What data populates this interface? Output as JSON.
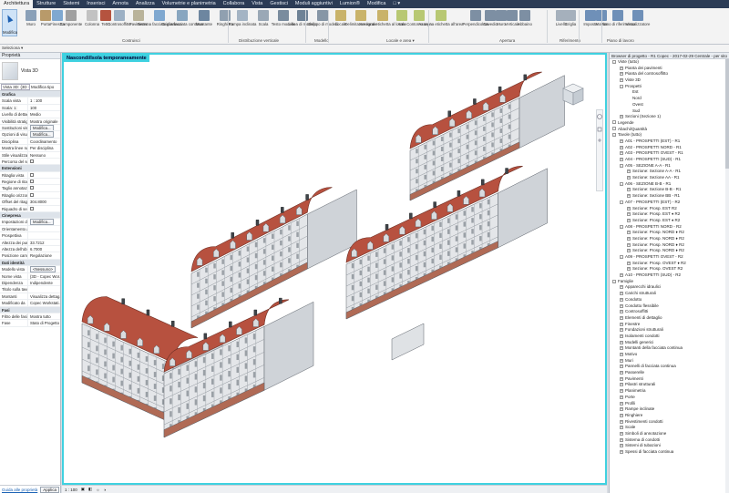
{
  "ribbon": {
    "tabs": [
      "Architettura",
      "Strutture",
      "Sistemi",
      "Inserisci",
      "Annota",
      "Analizza",
      "Volumetrie e planimetria",
      "Collabora",
      "Vista",
      "Gestisci",
      "Moduli aggiuntivi",
      "Lumion®",
      "Modifica",
      "□ ▾"
    ],
    "active_tab": "Architettura",
    "modify_label": "Modifica",
    "select_label": "Seleziona ▾",
    "buttons": [
      {
        "label": "Muro",
        "icon": "wall-icon"
      },
      {
        "label": "Porta",
        "icon": "door-icon"
      },
      {
        "label": "Finestra",
        "icon": "window-icon"
      },
      {
        "label": "Componente",
        "icon": "component-icon"
      },
      {
        "label": "Colonna",
        "icon": "column-icon"
      },
      {
        "label": "Tetto",
        "icon": "roof-icon"
      },
      {
        "label": "Controsoffitto",
        "icon": "ceiling-icon"
      },
      {
        "label": "Pavimento",
        "icon": "floor-icon"
      },
      {
        "label": "Sistema facciata continua",
        "icon": "curtain-system-icon"
      },
      {
        "label": "Griglia facciata continua",
        "icon": "curtain-grid-icon"
      },
      {
        "label": "Montante",
        "icon": "mullion-icon"
      },
      {
        "label": "Ringhiera",
        "icon": "railing-icon"
      },
      {
        "label": "Rampa inclinata",
        "icon": "ramp-icon"
      },
      {
        "label": "Scala",
        "icon": "stair-icon"
      },
      {
        "label": "Testo modello",
        "icon": "model-text-icon"
      },
      {
        "label": "Linea di modello",
        "icon": "model-line-icon"
      },
      {
        "label": "Gruppo di modelli",
        "icon": "model-group-icon"
      },
      {
        "label": "Locale",
        "icon": "room-icon"
      },
      {
        "label": "Delimitatore locale",
        "icon": "room-separator-icon"
      },
      {
        "label": "Assegna etichetta al locale",
        "icon": "tag-room-icon"
      },
      {
        "label": "Area",
        "icon": "area-icon"
      },
      {
        "label": "Contorno area",
        "icon": "area-boundary-icon"
      },
      {
        "label": "Assegna etichetta all'area",
        "icon": "tag-area-icon"
      },
      {
        "label": "Perpendicolare",
        "icon": "by-face-icon"
      },
      {
        "label": "Cavedio",
        "icon": "shaft-icon"
      },
      {
        "label": "Muro",
        "icon": "wall-opening-icon"
      },
      {
        "label": "Verticale",
        "icon": "vertical-icon"
      },
      {
        "label": "Abbaino",
        "icon": "dormer-icon"
      },
      {
        "label": "Livello",
        "icon": "level-icon"
      },
      {
        "label": "Griglia",
        "icon": "grid-icon"
      },
      {
        "label": "Imposta",
        "icon": "set-icon"
      },
      {
        "label": "Mostra",
        "icon": "show-icon"
      },
      {
        "label": "Piano di riferimento",
        "icon": "ref-plane-icon"
      },
      {
        "label": "Visualizzatore",
        "icon": "viewer-icon"
      }
    ],
    "groups": [
      "Costruisci",
      "Distribuzione verticale",
      "Modello",
      "Locale e area ▾",
      "Apertura",
      "Riferimento",
      "Piano di lavoro"
    ]
  },
  "properties": {
    "title": "Proprietà",
    "type_name": "Vista 3D",
    "view_selector": "Vista 3D: {3D - C",
    "edit_type": "Modifica tipo",
    "rows": [
      {
        "section": "Grafica"
      },
      {
        "k": "Scala vista",
        "v": "1 : 100"
      },
      {
        "k": "Scala: 1:",
        "v": "100"
      },
      {
        "k": "Livello di dettag...",
        "v": "Medio"
      },
      {
        "k": "Visibilità stratigr...",
        "v": "Mostra originale"
      },
      {
        "k": "Sostituzioni visi...",
        "v": "Modifica...",
        "btn": true
      },
      {
        "k": "Opzioni di visua...",
        "v": "Modifica...",
        "btn": true
      },
      {
        "k": "Disciplina",
        "v": "Coordinamento"
      },
      {
        "k": "Mostra linee na...",
        "v": "Per disciplina"
      },
      {
        "k": "Stile visualizzaz...",
        "v": "Nessuno"
      },
      {
        "k": "Percorso del sole",
        "v": "",
        "cb": true
      },
      {
        "section": "Estensioni"
      },
      {
        "k": "Ritaglia vista",
        "v": "",
        "cb": true
      },
      {
        "k": "Regione di ritagl...",
        "v": "",
        "cb": true
      },
      {
        "k": "Taglio annotaz...",
        "v": "",
        "cb": true
      },
      {
        "k": "Ritaglio orizzon...",
        "v": "",
        "cb": true
      },
      {
        "k": "Offset del ritagl...",
        "v": "304.8000"
      },
      {
        "k": "Riquadro di sezi...",
        "v": "",
        "cb": true
      },
      {
        "section": "Cinepresa"
      },
      {
        "k": "Impostazioni di ...",
        "v": "Modifica...",
        "btn": true
      },
      {
        "k": "Orientamento a...",
        "v": ""
      },
      {
        "k": "Prospettiva",
        "v": ""
      },
      {
        "k": "Altezza dei punt...",
        "v": "33.7212"
      },
      {
        "k": "Altezza dell'obi...",
        "v": "6.7000"
      },
      {
        "k": "Posizione came...",
        "v": "Regolazione"
      },
      {
        "section": "Dati identità"
      },
      {
        "k": "Modello vista",
        "v": "<Nessuno>",
        "btn": true
      },
      {
        "k": "Nome vista",
        "v": "{3D - Copec Wor..."
      },
      {
        "k": "Dipendenza",
        "v": "Indipendente"
      },
      {
        "k": "Titolo sulla tavola",
        "v": ""
      },
      {
        "k": "Montanti",
        "v": "Visualizza dettag..."
      },
      {
        "k": "Modificato da",
        "v": "Copec Workstati..."
      },
      {
        "section": "Fasi"
      },
      {
        "k": "Filtro delle fasi",
        "v": "Mostra tutto"
      },
      {
        "k": "Fase",
        "v": "Stato di Progetto"
      }
    ],
    "help_link": "Guida alle proprietà",
    "apply_label": "Applica"
  },
  "view": {
    "banner": "Nascondi/Isola temporaneamente",
    "scale": "1 : 100"
  },
  "browser": {
    "title": "Browser di progetto - R1 Copec - 2017-02-29 Centrale - per sito",
    "items": [
      {
        "d": 0,
        "t": "Viste (tutto)",
        "tg": "-"
      },
      {
        "d": 1,
        "t": "Pianta dei pavimenti",
        "tg": "+"
      },
      {
        "d": 1,
        "t": "Pianta del controsoffitto",
        "tg": "+"
      },
      {
        "d": 1,
        "t": "Viste 3D",
        "tg": "+"
      },
      {
        "d": 1,
        "t": "Prospetti",
        "tg": "-"
      },
      {
        "d": 2,
        "t": "Est"
      },
      {
        "d": 2,
        "t": "Nord"
      },
      {
        "d": 2,
        "t": "Ovest"
      },
      {
        "d": 2,
        "t": "Sud"
      },
      {
        "d": 1,
        "t": "Sezioni (Sezione 1)",
        "tg": "+"
      },
      {
        "d": 0,
        "t": "Legende",
        "tg": "▦"
      },
      {
        "d": 0,
        "t": "Abachi/Quantità",
        "tg": "▦"
      },
      {
        "d": 0,
        "t": "Tavole (tutto)",
        "tg": "-"
      },
      {
        "d": 1,
        "t": "A01 - PROSPETTI (EST) - R1",
        "tg": "+"
      },
      {
        "d": 1,
        "t": "A02 - PROSPETTI NORD - R1",
        "tg": "+"
      },
      {
        "d": 1,
        "t": "A03 - PROSPETTI OVEST - R1",
        "tg": "+"
      },
      {
        "d": 1,
        "t": "A04 - PROSPETTI (SUD) - R1",
        "tg": "+"
      },
      {
        "d": 1,
        "t": "A05 - SEZIONE A-A - R1",
        "tg": "-"
      },
      {
        "d": 2,
        "t": "Sezione: Sezione A-A - R1",
        "tg": "+"
      },
      {
        "d": 2,
        "t": "Sezione: Sezione AA - R1",
        "tg": "+"
      },
      {
        "d": 1,
        "t": "A06 - SEZIONE B-B - R1",
        "tg": "-"
      },
      {
        "d": 2,
        "t": "Sezione: Sezione B-B - R1",
        "tg": "+"
      },
      {
        "d": 2,
        "t": "Sezione: Sezione BB - R1",
        "tg": "+"
      },
      {
        "d": 1,
        "t": "A07 - PROSPETTI (EST) - R2",
        "tg": "-"
      },
      {
        "d": 2,
        "t": "Sezione: Prosp. EST R2",
        "tg": "+"
      },
      {
        "d": 2,
        "t": "Sezione: Prosp. EST ♦ R2",
        "tg": "+"
      },
      {
        "d": 2,
        "t": "Sezione: Prosp. EST ♦ R2",
        "tg": "+"
      },
      {
        "d": 1,
        "t": "A08 - PROSPETTI NORD - R2",
        "tg": "-"
      },
      {
        "d": 2,
        "t": "Sezione: Prosp. NORD ♦ R2",
        "tg": "+"
      },
      {
        "d": 2,
        "t": "Sezione: Prosp. NORD ♦ R2",
        "tg": "+"
      },
      {
        "d": 2,
        "t": "Sezione: Prosp. NORD ♦ R2",
        "tg": "+"
      },
      {
        "d": 2,
        "t": "Sezione: Prosp. NORD ♦ R2",
        "tg": "+"
      },
      {
        "d": 1,
        "t": "A09 - PROSPETTI OVEST - R2",
        "tg": "-"
      },
      {
        "d": 2,
        "t": "Sezione: Prosp. OVEST ♦ R2",
        "tg": "+"
      },
      {
        "d": 2,
        "t": "Sezione: Prosp. OVEST R2",
        "tg": "+"
      },
      {
        "d": 1,
        "t": "A10 - PROSPETTI (SUD) - R2",
        "tg": "+"
      },
      {
        "d": 0,
        "t": "Famiglie",
        "tg": "-"
      },
      {
        "d": 1,
        "t": "Apparecchi idraulici",
        "tg": "+"
      },
      {
        "d": 1,
        "t": "Carichi strutturali",
        "tg": "+"
      },
      {
        "d": 1,
        "t": "Condotto",
        "tg": "+"
      },
      {
        "d": 1,
        "t": "Condotto flessibile",
        "tg": "+"
      },
      {
        "d": 1,
        "t": "Controsoffitti",
        "tg": "+"
      },
      {
        "d": 1,
        "t": "Elementi di dettaglio",
        "tg": "+"
      },
      {
        "d": 1,
        "t": "Finestre",
        "tg": "+"
      },
      {
        "d": 1,
        "t": "Fondazioni strutturali",
        "tg": "+"
      },
      {
        "d": 1,
        "t": "Isolamenti condotti",
        "tg": "+"
      },
      {
        "d": 1,
        "t": "Modelli generici",
        "tg": "+"
      },
      {
        "d": 1,
        "t": "Montanti della facciata continua",
        "tg": "+"
      },
      {
        "d": 1,
        "t": "Motivo",
        "tg": "+"
      },
      {
        "d": 1,
        "t": "Muri",
        "tg": "+"
      },
      {
        "d": 1,
        "t": "Pannelli di facciata continua",
        "tg": "+"
      },
      {
        "d": 1,
        "t": "Passerelle",
        "tg": "+"
      },
      {
        "d": 1,
        "t": "Pavimenti",
        "tg": "+"
      },
      {
        "d": 1,
        "t": "Pilastri strutturali",
        "tg": "+"
      },
      {
        "d": 1,
        "t": "Planimetria",
        "tg": "+"
      },
      {
        "d": 1,
        "t": "Porte",
        "tg": "+"
      },
      {
        "d": 1,
        "t": "Profili",
        "tg": "+"
      },
      {
        "d": 1,
        "t": "Rampe inclinate",
        "tg": "+"
      },
      {
        "d": 1,
        "t": "Ringhiere",
        "tg": "+"
      },
      {
        "d": 1,
        "t": "Rivestimenti condotti",
        "tg": "+"
      },
      {
        "d": 1,
        "t": "Scale",
        "tg": "+"
      },
      {
        "d": 1,
        "t": "Simboli di annotazione",
        "tg": "+"
      },
      {
        "d": 1,
        "t": "Sistema di condotti",
        "tg": "+"
      },
      {
        "d": 1,
        "t": "Sistemi di tubazioni",
        "tg": "+"
      },
      {
        "d": 1,
        "t": "Spessi di facciata continua",
        "tg": "+"
      }
    ]
  },
  "colors": {
    "accent": "#3fd1e0",
    "roof": "#b7513f",
    "ribbon_tab_bg": "#2b3b55"
  }
}
